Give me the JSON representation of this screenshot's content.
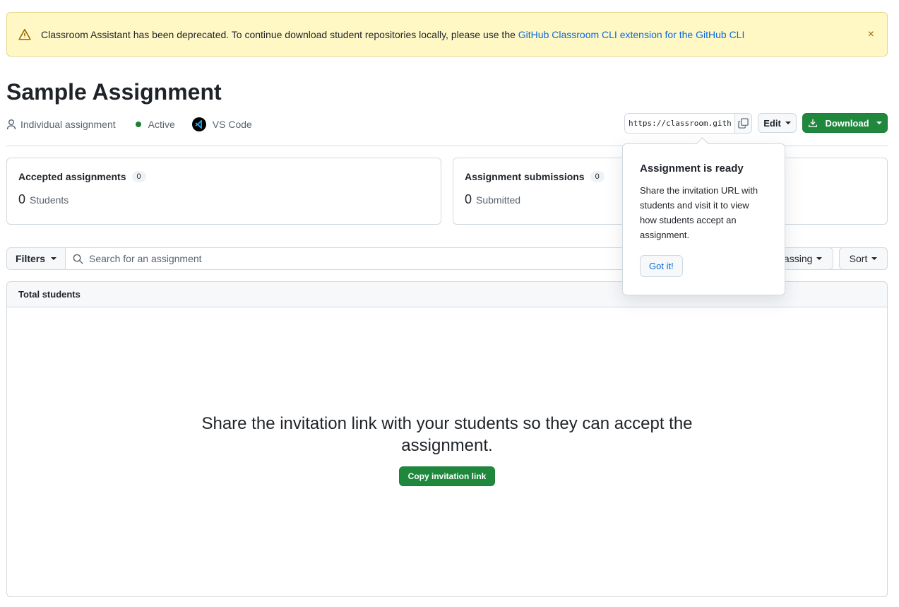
{
  "banner": {
    "text": "Classroom Assistant has been deprecated. To continue download student repositories locally, please use the ",
    "link": "GitHub Classroom CLI extension for the GitHub CLI",
    "close": "×"
  },
  "title": "Sample Assignment",
  "meta": {
    "type": "Individual assignment",
    "status": "Active",
    "editor": "VS Code"
  },
  "url": "https://classroom.github.com/",
  "buttons": {
    "edit": "Edit",
    "download": "Download"
  },
  "cards": [
    {
      "title": "Accepted assignments",
      "count": "0",
      "value": "0",
      "unit": "Students"
    },
    {
      "title": "Assignment submissions",
      "count": "0",
      "value": "0",
      "unit": "Submitted"
    }
  ],
  "filters": {
    "filter": "Filters",
    "search_placeholder": "Search for an assignment",
    "passing": "Passing",
    "sort": "Sort"
  },
  "table": {
    "header": "Total students",
    "empty_title": "Share the invitation link with your students so they can accept the assignment.",
    "copy": "Copy invitation link"
  },
  "popover": {
    "title": "Assignment is ready",
    "body": "Share the invitation URL with students and visit it to view how students accept an assignment.",
    "button": "Got it!"
  },
  "colors": {
    "accent": "#1f883d",
    "link": "#0969da",
    "warning_bg": "#fff8c5"
  }
}
